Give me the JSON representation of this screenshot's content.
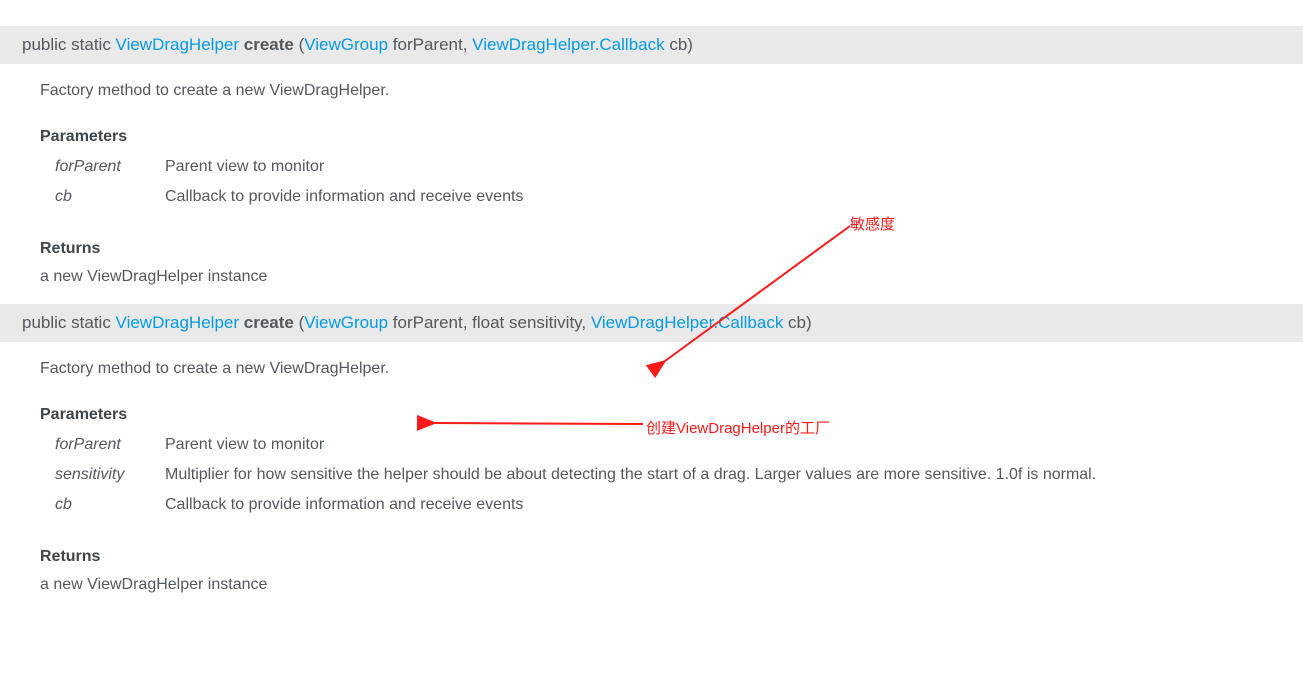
{
  "colors": {
    "link": "#039be5",
    "annotation": "#ff1a1a",
    "sig_bg": "#e9e9e9"
  },
  "method1": {
    "sig": {
      "prefix": "public static ",
      "return_type": "ViewDragHelper",
      "name": "create",
      "open": " (",
      "p1_type": "ViewGroup",
      "p1_name": " forParent, ",
      "p2_type": "ViewDragHelper.Callback",
      "p2_name": " cb)",
      "close": ""
    },
    "desc": "Factory method to create a new ViewDragHelper.",
    "params_heading": "Parameters",
    "params": [
      {
        "name": "forParent",
        "desc": "Parent view to monitor"
      },
      {
        "name": "cb",
        "desc": "Callback to provide information and receive events"
      }
    ],
    "returns_heading": "Returns",
    "returns": "a new ViewDragHelper instance"
  },
  "method2": {
    "sig": {
      "prefix": "public static ",
      "return_type": "ViewDragHelper",
      "name": "create",
      "open": " (",
      "p1_type": "ViewGroup",
      "p1_name": " forParent, float sensitivity, ",
      "p2_type": "ViewDragHelper.Callback",
      "p2_name": " cb)",
      "close": ""
    },
    "desc": "Factory method to create a new ViewDragHelper.",
    "params_heading": "Parameters",
    "params": [
      {
        "name": "forParent",
        "desc": "Parent view to monitor"
      },
      {
        "name": "sensitivity",
        "desc": "Multiplier for how sensitive the helper should be about detecting the start of a drag. Larger values are more sensitive. 1.0f is normal."
      },
      {
        "name": "cb",
        "desc": "Callback to provide information and receive events"
      }
    ],
    "returns_heading": "Returns",
    "returns": "a new ViewDragHelper instance"
  },
  "annotations": {
    "a1": {
      "text": "敏感度"
    },
    "a2": {
      "text": "创建ViewDragHelper的工厂"
    }
  }
}
